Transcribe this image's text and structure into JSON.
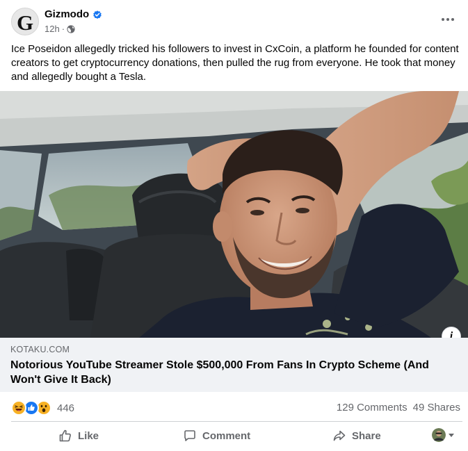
{
  "post": {
    "page_name": "Gizmodo",
    "avatar_letter": "G",
    "timestamp": "12h",
    "separator": "·",
    "audience_icon": "globe-icon",
    "verified_icon": "verified-badge-icon",
    "text": "Ice Poseidon allegedly tricked his followers to invest in CxCoin, a platform he founded for content creators to get cryptocurrency donations, then pulled the rug from everyone. He took that money and allegedly bought a Tesla."
  },
  "link": {
    "domain": "KOTAKU.COM",
    "title": "Notorious YouTube Streamer Stole $500,000 From Fans In Crypto Scheme (And Won't Give It Back)",
    "info_label": "i"
  },
  "stats": {
    "reactions": [
      "haha-icon",
      "like-icon",
      "wow-icon"
    ],
    "reaction_count": "446",
    "comments": "129 Comments",
    "shares": "49 Shares"
  },
  "actions": {
    "like": "Like",
    "comment": "Comment",
    "share": "Share"
  },
  "colors": {
    "brand_blue": "#1877f2",
    "secondary_text": "#65676b",
    "link_background": "#f0f2f5",
    "haha_yellow": "#f7b125",
    "like_blue": "#1877f2"
  }
}
